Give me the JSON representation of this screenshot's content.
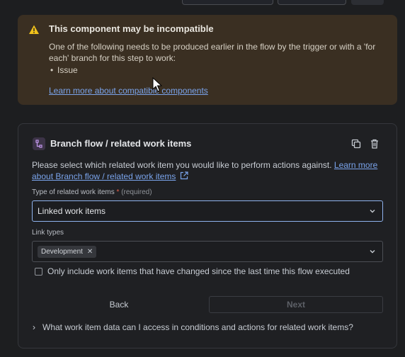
{
  "warning": {
    "title": "This component may be incompatible",
    "body": "One of the following needs to be produced earlier in the flow by the trigger or with a 'for each' branch for this step to work:",
    "items": [
      "Issue"
    ],
    "link": "Learn more about compatible components",
    "icon": "warning-icon",
    "accent": "#f1c21b"
  },
  "card": {
    "title": "Branch flow / related work items",
    "description": "Please select which related work item you would like to perform actions against.",
    "learn_more": "Learn more about Branch flow / related work items",
    "type_field": {
      "label": "Type of related work items",
      "required_mark": "*",
      "required_text": "(required)",
      "value": "Linked work items"
    },
    "link_types": {
      "label": "Link types",
      "chips": [
        "Development"
      ]
    },
    "checkbox_label": "Only include work items that have changed since the last time this flow executed",
    "back": "Back",
    "next": "Next",
    "faq": "What work item data can I access in conditions and actions for related work items?"
  },
  "colors": {
    "link": "#7aa4ec",
    "focus_border": "#8fb3ee",
    "warning_bg": "#3a2f22"
  }
}
